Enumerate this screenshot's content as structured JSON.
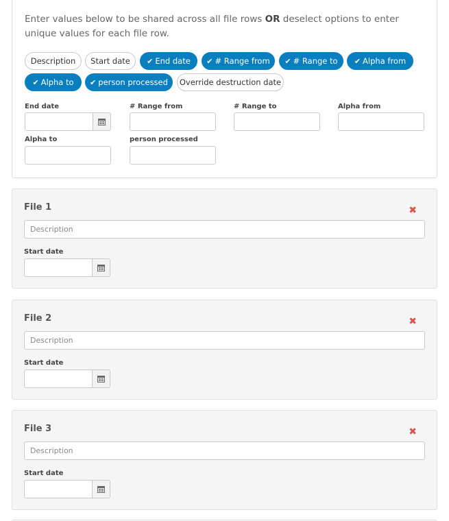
{
  "intro": {
    "text_before": "Enter values below to be shared across all file rows ",
    "bold": "OR",
    "text_after": " deselect options to enter unique values for each file row."
  },
  "pills": [
    {
      "label": "Description",
      "selected": false
    },
    {
      "label": "Start date",
      "selected": false
    },
    {
      "label": "End date",
      "selected": true
    },
    {
      "label": "# Range from",
      "selected": true
    },
    {
      "label": "# Range to",
      "selected": true
    },
    {
      "label": "Alpha from",
      "selected": true
    },
    {
      "label": "Alpha to",
      "selected": true
    },
    {
      "label": "person processed",
      "selected": true
    },
    {
      "label": "Override destruction date",
      "selected": false
    }
  ],
  "shared_fields": {
    "end_date": "End date",
    "range_from": "# Range from",
    "range_to": "# Range to",
    "alpha_from": "Alpha from",
    "alpha_to": "Alpha to",
    "person_processed": "person processed"
  },
  "files": [
    {
      "title": "File 1",
      "description_placeholder": "Description",
      "start_date_label": "Start date"
    },
    {
      "title": "File 2",
      "description_placeholder": "Description",
      "start_date_label": "Start date"
    },
    {
      "title": "File 3",
      "description_placeholder": "Description",
      "start_date_label": "Start date"
    }
  ],
  "icons": {
    "check": "✔",
    "close": "✖",
    "calendar": "calendar-icon"
  },
  "colors": {
    "accent": "#0a7fbf",
    "remove": "#d9534f",
    "card_bg": "#f5f5f5"
  }
}
